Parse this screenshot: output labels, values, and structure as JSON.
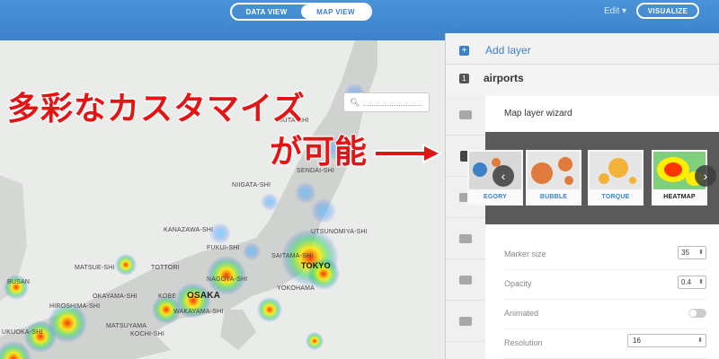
{
  "topbar": {
    "view_tabs": [
      "DATA VIEW",
      "MAP VIEW"
    ],
    "active_tab": "MAP VIEW",
    "edit_label": "Edit ▾",
    "visualize_label": "VISUALIZE",
    "accent": "#3d82c9"
  },
  "map": {
    "search_icon": "search-icon",
    "cities": [
      {
        "name": "AKITA-SHI"
      },
      {
        "name": "SENDAI-SHI"
      },
      {
        "name": "NIIGATA-SHI"
      },
      {
        "name": "KANAZAWA-SHI"
      },
      {
        "name": "UTSUNOMIYA-SHI"
      },
      {
        "name": "FUKUI-SHI"
      },
      {
        "name": "SAITAMA-SHI"
      },
      {
        "name": "TOKYO"
      },
      {
        "name": "MATSUE-SHI"
      },
      {
        "name": "TOTTORI"
      },
      {
        "name": "NAGOYA-SHI"
      },
      {
        "name": "YOKOHAMA"
      },
      {
        "name": "OKAYAMA-SHI"
      },
      {
        "name": "KOBE"
      },
      {
        "name": "OSAKA"
      },
      {
        "name": "HIROSHIMA-SHI"
      },
      {
        "name": "BUSAN"
      },
      {
        "name": "WAKAYAMA-SHI"
      },
      {
        "name": "MATSUYAMA"
      },
      {
        "name": "UKUOKA-SHI"
      },
      {
        "name": "KOCHI-SHI"
      }
    ]
  },
  "overlay": {
    "line1": "多彩なカスタマイズ",
    "line2": "が可能",
    "color": "#e31414"
  },
  "panel": {
    "add_layer": "Add layer",
    "layer_number": "1",
    "layer_name": "airports",
    "wizard_title": "Map layer wizard",
    "wizard_types": [
      "EGORY",
      "BUBBLE",
      "TORQUE",
      "HEATMAP"
    ],
    "selected_type": "HEATMAP",
    "settings": {
      "marker_size_label": "Marker size",
      "marker_size_value": "35",
      "opacity_label": "Opacity",
      "opacity_value": "0.4",
      "animated_label": "Animated",
      "resolution_label": "Resolution",
      "resolution_value": "16"
    }
  }
}
